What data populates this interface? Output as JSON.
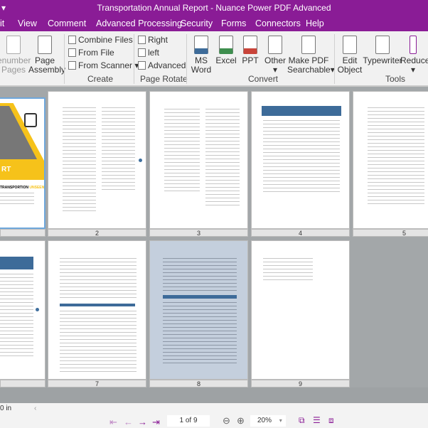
{
  "window": {
    "title": "Transportation Annual Report - Nuance Power PDF Advanced"
  },
  "menu": [
    "it",
    "View",
    "Comment",
    "Advanced Processing",
    "Security",
    "Forms",
    "Connectors",
    "Help"
  ],
  "ribbon": {
    "renumber": "enumber\nPages",
    "page_assembly": [
      "Page",
      "Assembly"
    ],
    "create": {
      "items": [
        "Combine Files",
        "From File",
        "From Scanner"
      ],
      "label": "Create"
    },
    "rotate": {
      "items": [
        "Right",
        "left",
        "Advanced"
      ],
      "label": "Page Rotate"
    },
    "convert": {
      "items": [
        [
          "MS",
          "Word"
        ],
        [
          "Excel",
          ""
        ],
        [
          "PPT",
          ""
        ],
        [
          "Other",
          ""
        ],
        [
          "Make PDF",
          "Searchable"
        ]
      ],
      "label": "Convert"
    },
    "tools": {
      "items": [
        [
          "Edit",
          "Object"
        ],
        [
          "Typewriter",
          ""
        ],
        [
          "Reduce",
          ""
        ]
      ],
      "label": "Tools"
    },
    "colors": {
      "word": "#3d6b99",
      "excel": "#3e8e4e",
      "ppt": "#c9443a"
    }
  },
  "pages": [
    {
      "n": "2"
    },
    {
      "n": "3"
    },
    {
      "n": "4"
    },
    {
      "n": "5"
    },
    {
      "n": "7"
    },
    {
      "n": "8"
    },
    {
      "n": "9"
    }
  ],
  "cover": {
    "word": "RT",
    "heading": "TRANSPORTION",
    "heading_accent": "UNSEEN"
  },
  "status": {
    "measure": "0 in",
    "page_field": "1 of 9",
    "zoom": "20%"
  },
  "accent": "#8a1c96"
}
